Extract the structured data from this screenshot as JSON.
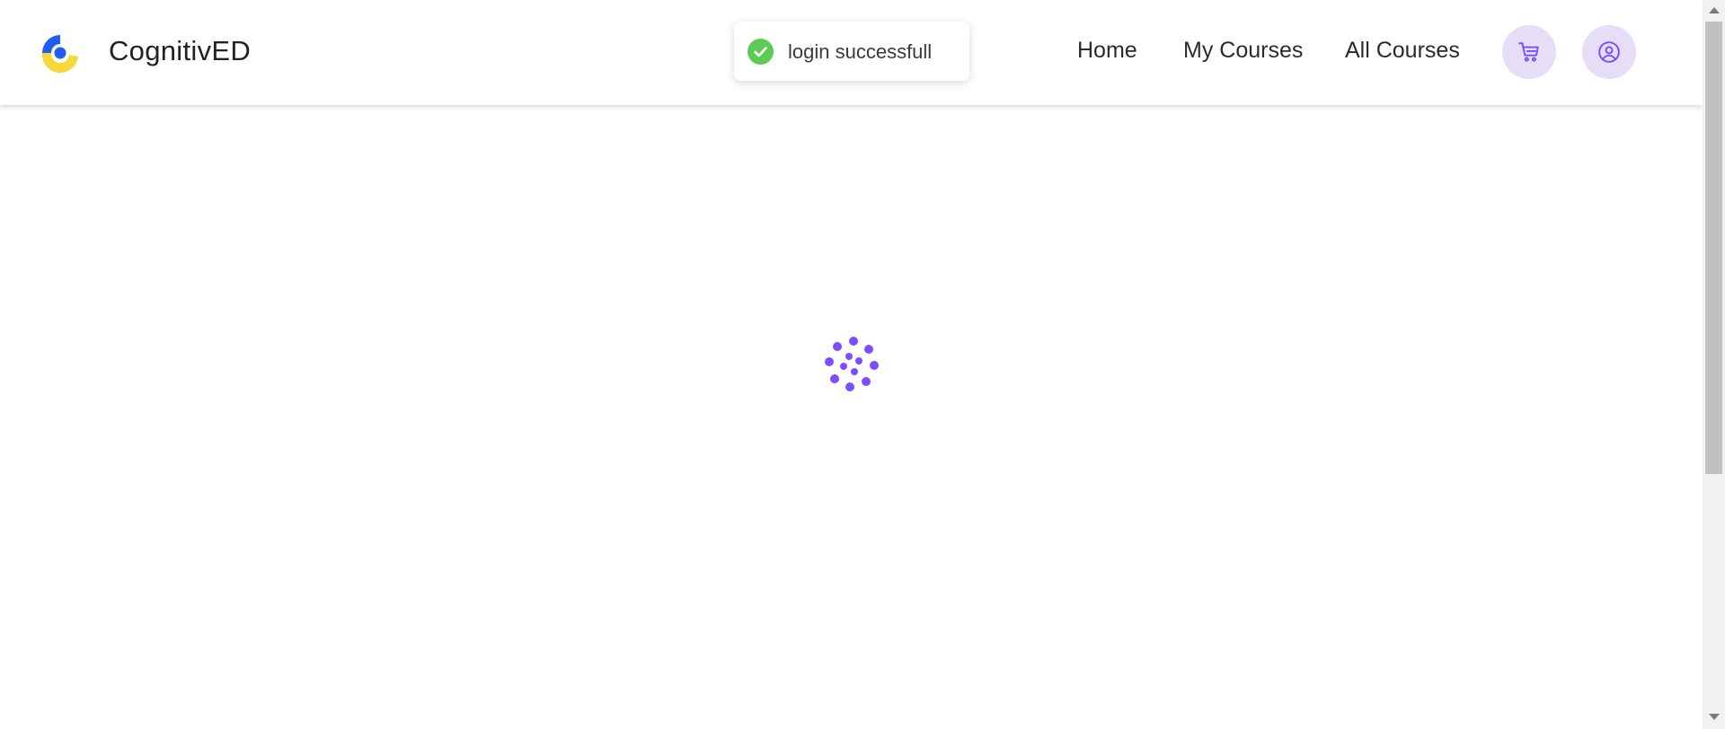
{
  "header": {
    "brand": "CognitivED",
    "logo_icon": "cognitived-logo-icon",
    "nav": {
      "home": "Home",
      "my_courses": "My Courses",
      "all_courses": "All Courses"
    },
    "cart_icon": "cart-icon",
    "profile_icon": "user-circle-icon"
  },
  "toast": {
    "icon": "check-circle-icon",
    "message": "login successfull"
  },
  "main": {
    "spinner_icon": "loading-spinner-icon"
  },
  "colors": {
    "accent": "#7c4dff",
    "accent_light": "#e6ddf6",
    "success": "#5ccc55",
    "logo_blue": "#1f5ef0",
    "logo_yellow": "#f5d83a"
  }
}
